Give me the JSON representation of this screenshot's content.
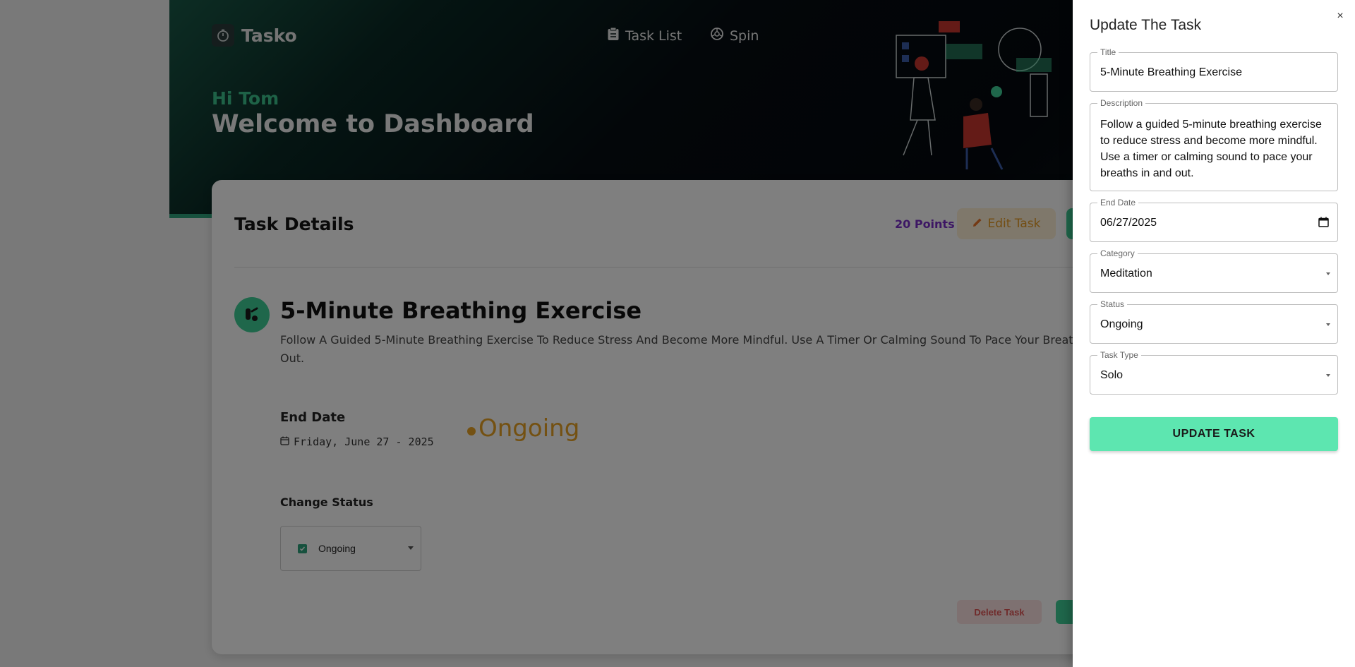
{
  "header": {
    "logo_text": "Tasko",
    "nav": [
      {
        "label": "Task List",
        "icon": "clipboard-icon"
      },
      {
        "label": "Spin",
        "icon": "spin-icon"
      }
    ],
    "greeting": "Hi Tom",
    "welcome": "Welcome to Dashboard"
  },
  "task_card": {
    "title": "Task Details",
    "points": "20 Points",
    "edit_label": "Edit Task",
    "task_name": "5-Minute Breathing Exercise",
    "description": "Follow A Guided 5-Minute Breathing Exercise To Reduce Stress And Become More Mindful. Use A Timer Or Calming Sound To Pace Your Breaths In And Out.",
    "end_date_label": "End Date",
    "end_date_value": "Friday, June 27 - 2025",
    "status": "Ongoing",
    "change_status_label": "Change Status",
    "change_status_value": "Ongoing",
    "delete_label": "Delete Task"
  },
  "drawer": {
    "title": "Update The Task",
    "close": "×",
    "fields": {
      "title": {
        "label": "Title",
        "value": "5-Minute Breathing Exercise"
      },
      "description": {
        "label": "Description",
        "value": "Follow a guided 5-minute breathing exercise to reduce stress and become more mindful. Use a timer or calming sound to pace your breaths in and out."
      },
      "end_date": {
        "label": "End Date",
        "value": "06/27/2025"
      },
      "category": {
        "label": "Category",
        "value": "Meditation"
      },
      "status": {
        "label": "Status",
        "value": "Ongoing"
      },
      "task_type": {
        "label": "Task Type",
        "value": "Solo"
      }
    },
    "submit_label": "Update Task"
  },
  "colors": {
    "accent": "#3fcf96",
    "status": "#e8a224",
    "points": "#7a2fc9",
    "update_button": "#5de6b0"
  }
}
